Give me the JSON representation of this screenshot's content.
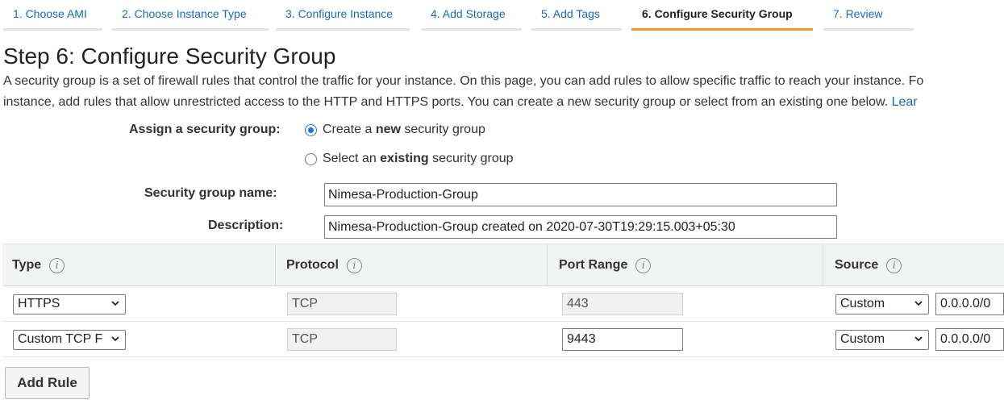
{
  "wizard_tabs": [
    {
      "label": "1. Choose AMI",
      "active": false
    },
    {
      "label": "2. Choose Instance Type",
      "active": false
    },
    {
      "label": "3. Configure Instance",
      "active": false
    },
    {
      "label": "4. Add Storage",
      "active": false
    },
    {
      "label": "5. Add Tags",
      "active": false
    },
    {
      "label": "6. Configure Security Group",
      "active": true
    },
    {
      "label": "7. Review",
      "active": false
    }
  ],
  "page": {
    "title": "Step 6: Configure Security Group",
    "intro_line1": "A security group is a set of firewall rules that control the traffic for your instance. On this page, you can add rules to allow specific traffic to reach your instance. Fo",
    "intro_line2": "instance, add rules that allow unrestricted access to the HTTP and HTTPS ports. You can create a new security group or select from an existing one below. ",
    "intro_link": "Lear"
  },
  "assign": {
    "label": "Assign a security group:",
    "options": [
      {
        "before": "Create a ",
        "bold": "new",
        "after": " security group",
        "selected": true
      },
      {
        "before": "Select an ",
        "bold": "existing",
        "after": " security group",
        "selected": false
      }
    ]
  },
  "form": {
    "name_label": "Security group name:",
    "name_value": "Nimesa-Production-Group",
    "description_label": "Description:",
    "description_value": "Nimesa-Production-Group created on 2020-07-30T19:29:15.003+05:30"
  },
  "table": {
    "headers": [
      "Type",
      "Protocol",
      "Port Range",
      "Source"
    ],
    "info_glyph": "i",
    "rows": [
      {
        "type": "HTTPS",
        "protocol": "TCP",
        "port": "443",
        "port_editable": false,
        "source_type": "Custom",
        "source_value": "0.0.0.0/0"
      },
      {
        "type": "Custom TCP F",
        "protocol": "TCP",
        "port": "9443",
        "port_editable": true,
        "source_type": "Custom",
        "source_value": "0.0.0.0/0"
      }
    ]
  },
  "add_rule_label": "Add Rule",
  "colors": {
    "link": "#1a6bb5",
    "active_tab_underline": "#ec9a2a",
    "table_header_bg": "#f2f3f3"
  }
}
